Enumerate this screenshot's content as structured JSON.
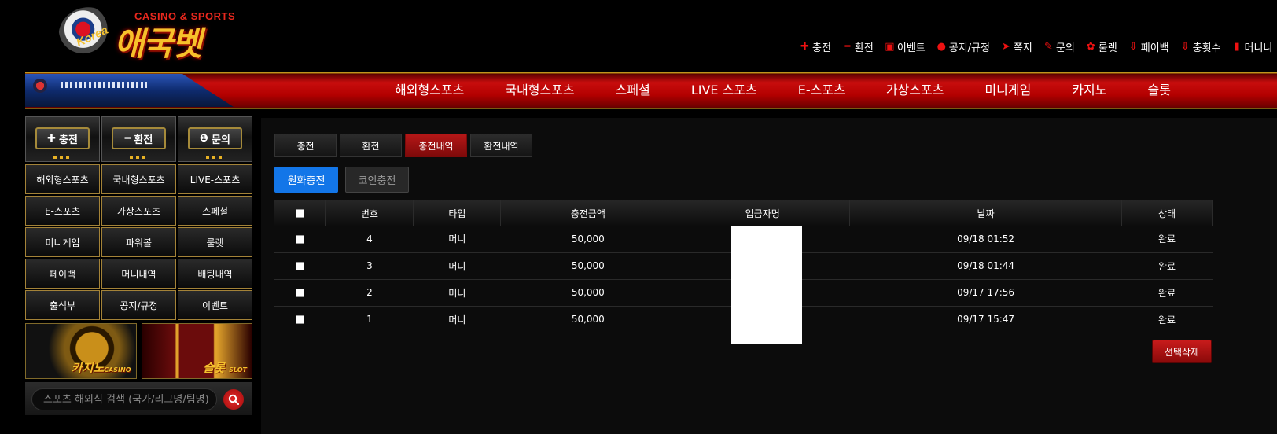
{
  "logo": {
    "tagline": "CASINO & SPORTS",
    "name": "애국벳",
    "badge": "Korea"
  },
  "top_menu": [
    {
      "icon": "plus-icon",
      "glyph": "✚",
      "label": "충전"
    },
    {
      "icon": "minus-icon",
      "glyph": "━",
      "label": "환전"
    },
    {
      "icon": "calendar-icon",
      "glyph": "▣",
      "label": "이벤트"
    },
    {
      "icon": "alert-icon",
      "glyph": "●",
      "label": "공지/규정"
    },
    {
      "icon": "send-icon",
      "glyph": "➤",
      "label": "쪽지"
    },
    {
      "icon": "edit-icon",
      "glyph": "✎",
      "label": "문의"
    },
    {
      "icon": "gift-icon",
      "glyph": "✿",
      "label": "룰렛"
    },
    {
      "icon": "payback-icon",
      "glyph": "⇩",
      "label": "페이백"
    },
    {
      "icon": "count-icon",
      "glyph": "⇩",
      "label": "충횟수"
    },
    {
      "icon": "clipboard-icon",
      "glyph": "▮",
      "label": "머니니"
    }
  ],
  "nav": [
    "해외형스포츠",
    "국내형스포츠",
    "스페셜",
    "LIVE 스포츠",
    "E-스포츠",
    "가상스포츠",
    "미니게임",
    "카지노",
    "슬롯"
  ],
  "quick_buttons": [
    {
      "icon": "plus-icon",
      "glyph": "✚",
      "label": "충전"
    },
    {
      "icon": "minus-icon",
      "glyph": "━",
      "label": "환전"
    },
    {
      "icon": "info-icon",
      "glyph": "❶",
      "label": "문의"
    }
  ],
  "side_grid": [
    "해외형스포츠",
    "국내형스포츠",
    "LIVE-스포츠",
    "E-스포츠",
    "가상스포츠",
    "스페셜",
    "미니게임",
    "파워볼",
    "룰렛",
    "페이백",
    "머니내역",
    "배팅내역",
    "출석부",
    "공지/규정",
    "이벤트"
  ],
  "banners": {
    "casino": {
      "title": "카지노",
      "sub": "CASINO"
    },
    "slot": {
      "title": "슬롯",
      "sub": "SLOT"
    }
  },
  "search": {
    "placeholder": "스포츠 해외식 검색 (국가/리그명/팀명)"
  },
  "tabs": [
    {
      "label": "충전",
      "active": false
    },
    {
      "label": "환전",
      "active": false
    },
    {
      "label": "충전내역",
      "active": true
    },
    {
      "label": "환전내역",
      "active": false
    }
  ],
  "subtabs": [
    {
      "label": "원화충전",
      "active": true
    },
    {
      "label": "코인충전",
      "active": false
    }
  ],
  "table": {
    "columns": [
      "번호",
      "타입",
      "충전금액",
      "입금자명",
      "날짜",
      "상태"
    ],
    "rows": [
      {
        "no": "4",
        "type": "머니",
        "amount": "50,000",
        "depositor": "",
        "date": "09/18 01:52",
        "status": "완료"
      },
      {
        "no": "3",
        "type": "머니",
        "amount": "50,000",
        "depositor": "",
        "date": "09/18 01:44",
        "status": "완료"
      },
      {
        "no": "2",
        "type": "머니",
        "amount": "50,000",
        "depositor": "",
        "date": "09/17 17:56",
        "status": "완료"
      },
      {
        "no": "1",
        "type": "머니",
        "amount": "50,000",
        "depositor": "",
        "date": "09/17 15:47",
        "status": "완료"
      }
    ]
  },
  "actions": {
    "delete_selected": "선택삭제"
  },
  "colors": {
    "accent_red": "#b41717",
    "primary_blue": "#1376e8",
    "gold": "#a48338"
  }
}
